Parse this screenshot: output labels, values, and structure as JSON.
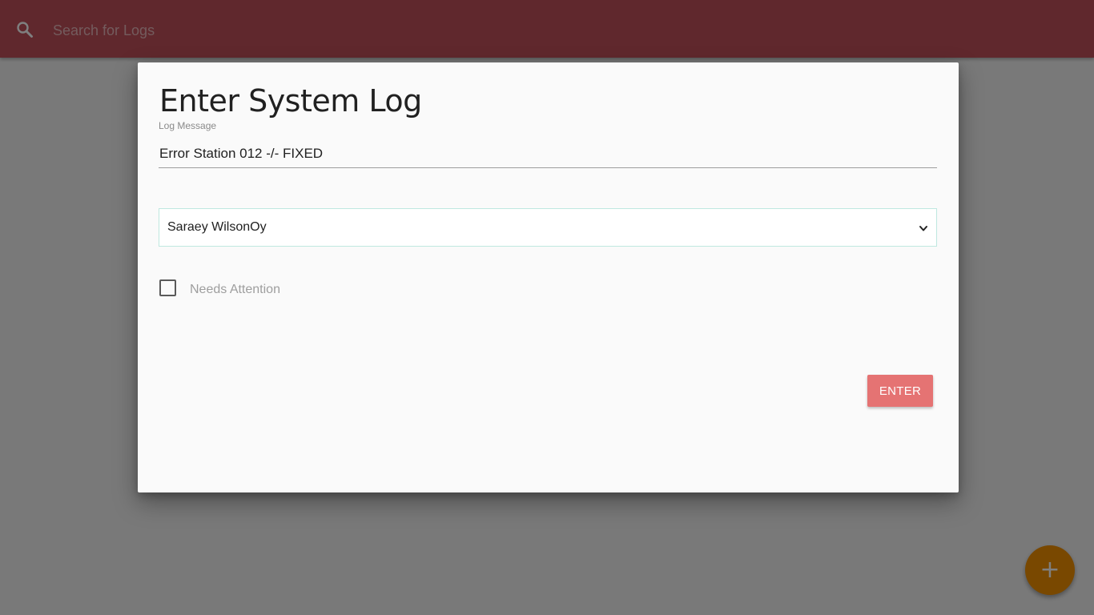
{
  "topbar": {
    "search_placeholder": "Search for Logs",
    "search_icon": "search-icon",
    "color": "#c0505a"
  },
  "modal": {
    "title": "Enter System Log",
    "log_message_label": "Log Message",
    "log_message_value": "Error Station 012 -/- FIXED",
    "assignee_selected": "Saraey WilsonOy",
    "needs_attention_label": "Needs Attention",
    "needs_attention_checked": false,
    "enter_label": "ENTER",
    "enter_color": "#e57373"
  },
  "fab": {
    "icon": "plus-icon",
    "glyph": "+",
    "color": "#f39100"
  }
}
